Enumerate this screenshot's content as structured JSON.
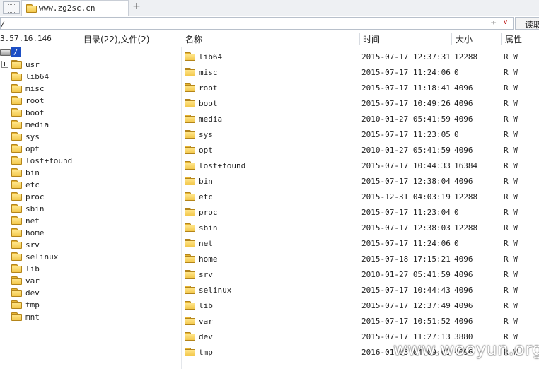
{
  "tab": {
    "title": "www.zg2sc.cn"
  },
  "address": {
    "path": "/",
    "read_label": "读取"
  },
  "header": {
    "ip": "3.57.16.146",
    "count": "目录(22),文件(2)",
    "col_name": "名称",
    "col_time": "时间",
    "col_size": "大小",
    "col_attr": "属性"
  },
  "tree": {
    "root_label": "/",
    "items": [
      "usr",
      "lib64",
      "misc",
      "root",
      "boot",
      "media",
      "sys",
      "opt",
      "lost+found",
      "bin",
      "etc",
      "proc",
      "sbin",
      "net",
      "home",
      "srv",
      "selinux",
      "lib",
      "var",
      "dev",
      "tmp",
      "mnt"
    ]
  },
  "files": [
    {
      "name": "lib64",
      "time": "2015-07-17 12:37:31",
      "size": "12288",
      "attr": "R W"
    },
    {
      "name": "misc",
      "time": "2015-07-17 11:24:06",
      "size": "0",
      "attr": "R W"
    },
    {
      "name": "root",
      "time": "2015-07-17 11:18:41",
      "size": "4096",
      "attr": "R W"
    },
    {
      "name": "boot",
      "time": "2015-07-17 10:49:26",
      "size": "4096",
      "attr": "R W"
    },
    {
      "name": "media",
      "time": "2010-01-27 05:41:59",
      "size": "4096",
      "attr": "R W"
    },
    {
      "name": "sys",
      "time": "2015-07-17 11:23:05",
      "size": "0",
      "attr": "R W"
    },
    {
      "name": "opt",
      "time": "2010-01-27 05:41:59",
      "size": "4096",
      "attr": "R W"
    },
    {
      "name": "lost+found",
      "time": "2015-07-17 10:44:33",
      "size": "16384",
      "attr": "R W"
    },
    {
      "name": "bin",
      "time": "2015-07-17 12:38:04",
      "size": "4096",
      "attr": "R W"
    },
    {
      "name": "etc",
      "time": "2015-12-31 04:03:19",
      "size": "12288",
      "attr": "R W"
    },
    {
      "name": "proc",
      "time": "2015-07-17 11:23:04",
      "size": "0",
      "attr": "R W"
    },
    {
      "name": "sbin",
      "time": "2015-07-17 12:38:03",
      "size": "12288",
      "attr": "R W"
    },
    {
      "name": "net",
      "time": "2015-07-17 11:24:06",
      "size": "0",
      "attr": "R W"
    },
    {
      "name": "home",
      "time": "2015-07-18 17:15:21",
      "size": "4096",
      "attr": "R W"
    },
    {
      "name": "srv",
      "time": "2010-01-27 05:41:59",
      "size": "4096",
      "attr": "R W"
    },
    {
      "name": "selinux",
      "time": "2015-07-17 10:44:43",
      "size": "4096",
      "attr": "R W"
    },
    {
      "name": "lib",
      "time": "2015-07-17 12:37:49",
      "size": "4096",
      "attr": "R W"
    },
    {
      "name": "var",
      "time": "2015-07-17 10:51:52",
      "size": "4096",
      "attr": "R W"
    },
    {
      "name": "dev",
      "time": "2015-07-17 11:27:13",
      "size": "3880",
      "attr": "R W"
    },
    {
      "name": "tmp",
      "time": "2016-01-03 04:09:01",
      "size": "4096",
      "attr": "R W"
    }
  ],
  "watermark": "www.wooyun.org"
}
